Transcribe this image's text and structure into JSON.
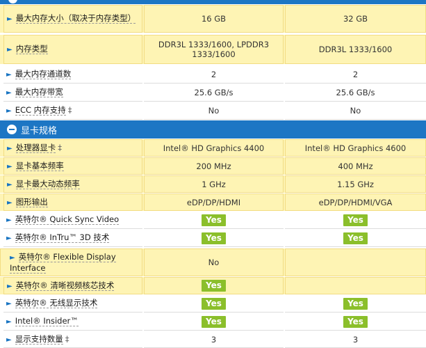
{
  "memory_rows": [
    {
      "label": "最大内存大小（取决于内存类型）",
      "sup": "",
      "v1": "16 GB",
      "v2": "32 GB"
    },
    {
      "label": "内存类型",
      "sup": "",
      "v1": "DDR3L 1333/1600, LPDDR3 1333/1600",
      "v2": "DDR3L 1333/1600"
    },
    {
      "label": "最大内存通道数",
      "sup": "",
      "v1": "2",
      "v2": "2"
    },
    {
      "label": "最大内存带宽",
      "sup": "",
      "v1": "25.6 GB/s",
      "v2": "25.6 GB/s"
    },
    {
      "label": "ECC 内存支持",
      "sup": "‡",
      "v1": "No",
      "v2": "No"
    }
  ],
  "section_graphics": {
    "title": "显卡规格"
  },
  "graphics_rows": [
    {
      "label": "处理器显卡",
      "sup": "‡",
      "v1": "Intel® HD Graphics 4400",
      "v2": "Intel® HD Graphics 4600"
    },
    {
      "label": "显卡基本频率",
      "sup": "",
      "v1": "200 MHz",
      "v2": "400 MHz"
    },
    {
      "label": "显卡最大动态频率",
      "sup": "",
      "v1": "1 GHz",
      "v2": "1.15 GHz"
    },
    {
      "label": "图形输出",
      "sup": "",
      "v1": "eDP/DP/HDMI",
      "v2": "eDP/DP/HDMI/VGA"
    },
    {
      "label": "英特尔® Quick Sync Video",
      "sup": "",
      "v1": "Yes",
      "v2": "Yes"
    },
    {
      "label": "英特尔® InTru™ 3D 技术",
      "sup": "",
      "v1": "Yes",
      "v2": "Yes"
    },
    {
      "label": "英特尔® Flexible Display Interface",
      "sup": "",
      "v1": "No",
      "v2": ""
    },
    {
      "label": "英特尔® 清晰视频核芯技术",
      "sup": "",
      "v1": "Yes",
      "v2": ""
    },
    {
      "label": "英特尔® 无线显示技术",
      "sup": "",
      "v1": "Yes",
      "v2": "Yes"
    },
    {
      "label": "Intel® Insider™",
      "sup": "",
      "v1": "Yes",
      "v2": "Yes"
    },
    {
      "label": "显示支持数量",
      "sup": "‡",
      "v1": "3",
      "v2": "3"
    }
  ],
  "yes_badge_style": {
    "background": "#8bbf2b",
    "color": "#ffffff"
  },
  "colors": {
    "section_blue": "#1d76c4",
    "highlight_row": "#fef4b4",
    "arrow_blue": "#1874c2"
  }
}
